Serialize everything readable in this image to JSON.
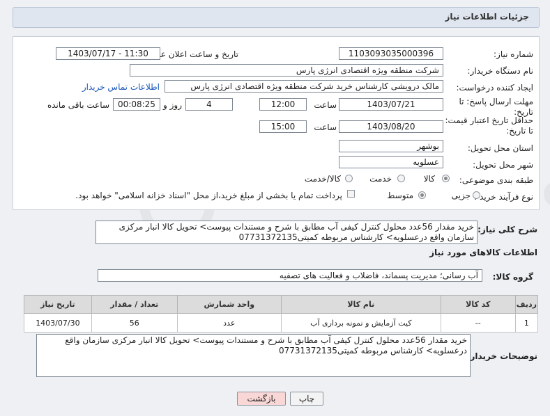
{
  "header": {
    "title": "جزئیات اطلاعات نیاز"
  },
  "fields": {
    "need_number_label": "شماره نیاز:",
    "need_number": "1103093035000396",
    "announce_label": "تاریخ و ساعت اعلان عمومی:",
    "announce_value": "1403/07/17 - 11:30",
    "buyer_org_label": "نام دستگاه خریدار:",
    "buyer_org": "شرکت منطقه ویژه اقتصادی انرژی پارس",
    "creator_label": "ایجاد کننده درخواست:",
    "creator": "مالک  درویشی کارشناس خرید شرکت منطقه ویژه اقتصادی انرژی پارس",
    "contact_link": "اطلاعات تماس خریدار",
    "deadline_label": "مهلت ارسال پاسخ: تا تاریخ:",
    "deadline_date": "1403/07/21",
    "time_label": "ساعت",
    "deadline_time": "12:00",
    "days_value": "4",
    "days_label": "روز و",
    "remaining_value": "00:08:25",
    "remaining_label": "ساعت باقی مانده",
    "validity_label": "حداقل تاریخ اعتبار قیمت: تا تاریخ:",
    "validity_date": "1403/08/20",
    "validity_time": "15:00",
    "province_label": "استان محل تحویل:",
    "province": "بوشهر",
    "city_label": "شهر محل تحویل:",
    "city": "عسلویه",
    "category_label": "طبقه بندی موضوعی:",
    "category_options": [
      "کالا",
      "خدمت",
      "کالا/خدمت"
    ],
    "purchase_type_label": "نوع فرآیند خرید :",
    "purchase_options": [
      "جزیی",
      "متوسط"
    ],
    "payment_note": "پرداخت تمام یا بخشی از مبلغ خرید،از محل \"اسناد خزانه اسلامی\" خواهد بود."
  },
  "general_desc_label": "شرح کلی نیاز:",
  "general_desc": "خرید مقدار 56عدد محلول کنترل کیفی آب مطابق با شرح  و مستندات پیوست> تحویل کالا انبار مرکزی سازمان  واقع درعسلویه> کارشناس مربوطه کمیتی07731372135",
  "goods_section_title": "اطلاعات کالاهای مورد نیاز",
  "goods_group_label": "گروه کالا:",
  "goods_group": "آب رسانی؛ مدیریت پسماند، فاضلاب و فعالیت های تصفیه",
  "table": {
    "headers": [
      "ردیف",
      "کد کالا",
      "نام کالا",
      "واحد شمارش",
      "تعداد / مقدار",
      "تاریخ نیاز"
    ],
    "rows": [
      [
        "1",
        "--",
        "کیت آزمایش و نمونه برداری آب",
        "عدد",
        "56",
        "1403/07/30"
      ]
    ]
  },
  "buyer_desc_label": "توضیحات خریدار:",
  "buyer_desc": "خرید مقدار 56عدد محلول کنترل کیفی آب مطابق با شرح  و مستندات پیوست> تحویل کالا انبار مرکزی سازمان  واقع درعسلویه> کارشناس مربوطه کمیتی07731372135",
  "buttons": {
    "print": "چاپ",
    "back": "بازگشت"
  },
  "watermark": "AriaTender.neT",
  "colors": {
    "header_bg": "#dfe6f0",
    "link": "#1a57b8",
    "back_button": "#f9d7d7"
  }
}
